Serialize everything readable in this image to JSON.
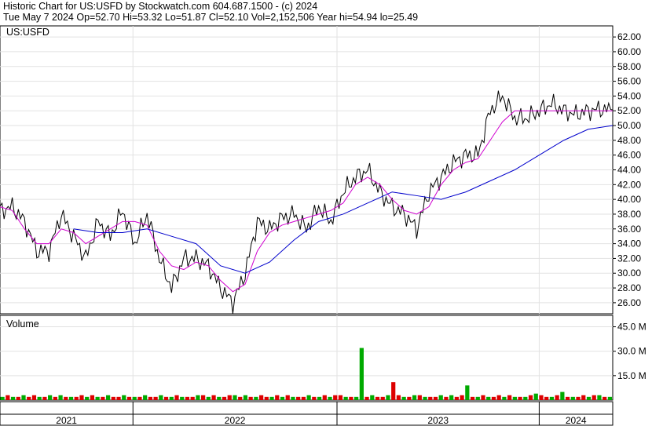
{
  "header": {
    "line1": "Historic Chart for US:USFD by Stockwatch.com 604.687.1500 - (c) 2024",
    "line2": "Tue May  7 2024  Op=52.70  Hi=53.32  Lo=51.87  Cl=52.10  Vol=2,152,506  Year hi=54.94  lo=25.49"
  },
  "chart_data": [
    {
      "type": "line",
      "panel": "price",
      "title": "US:USFD",
      "ylim": [
        24.5,
        63.5
      ],
      "yticks": [
        "62.00",
        "60.00",
        "58.00",
        "56.00",
        "54.00",
        "52.00",
        "50.00",
        "48.00",
        "46.00",
        "44.00",
        "42.00",
        "40.00",
        "38.00",
        "36.00",
        "34.00",
        "32.00",
        "30.00",
        "28.00",
        "26.00"
      ],
      "x_labels": [
        "2021",
        "2022",
        "2023",
        "2024"
      ],
      "grid": true,
      "colors": {
        "price": "#000000",
        "ma_short": "#d000d0",
        "ma_long": "#0000cc"
      },
      "series": [
        {
          "key": "price",
          "x": [
            0,
            0.02,
            0.04,
            0.06,
            0.08,
            0.1,
            0.12,
            0.14,
            0.16,
            0.18,
            0.2,
            0.22,
            0.24,
            0.26,
            0.28,
            0.3,
            0.32,
            0.34,
            0.36,
            0.38,
            0.4,
            0.42,
            0.44,
            0.46,
            0.48,
            0.5,
            0.52,
            0.54,
            0.56,
            0.58,
            0.6,
            0.62,
            0.64,
            0.66,
            0.68,
            0.7,
            0.72,
            0.74,
            0.76,
            0.78,
            0.8,
            0.82,
            0.84,
            0.86,
            0.88,
            0.9,
            0.92,
            0.94,
            0.96,
            0.98,
            1.0
          ],
          "values": [
            38.5,
            39,
            37,
            33,
            33,
            38,
            35,
            32,
            37,
            35,
            38.5,
            34,
            38,
            32,
            28,
            32,
            32,
            31,
            28,
            26,
            30,
            37,
            36,
            37.5,
            38,
            36,
            39,
            37,
            41,
            43,
            44,
            41,
            39,
            38,
            36,
            41,
            43,
            45,
            46,
            46,
            52,
            54,
            51,
            51,
            52,
            53,
            52,
            51.5,
            52,
            52.2,
            52.1
          ]
        },
        {
          "key": "ma_short",
          "x": [
            0,
            0.02,
            0.04,
            0.06,
            0.08,
            0.1,
            0.12,
            0.14,
            0.16,
            0.18,
            0.2,
            0.22,
            0.24,
            0.26,
            0.28,
            0.3,
            0.32,
            0.34,
            0.36,
            0.38,
            0.4,
            0.42,
            0.44,
            0.46,
            0.48,
            0.5,
            0.52,
            0.54,
            0.56,
            0.58,
            0.6,
            0.62,
            0.64,
            0.66,
            0.68,
            0.7,
            0.72,
            0.74,
            0.76,
            0.78,
            0.8,
            0.82,
            0.84,
            0.86,
            0.88,
            0.9,
            0.92,
            0.94,
            0.96,
            0.98,
            1.0
          ],
          "values": [
            39,
            38.5,
            36,
            34,
            34,
            36,
            35.5,
            34,
            35,
            36,
            37,
            37,
            36.5,
            33,
            31,
            30.5,
            31.5,
            31,
            29,
            27.5,
            28.5,
            33,
            35.5,
            36.5,
            37,
            37.5,
            38,
            38.5,
            39.5,
            42,
            43,
            42,
            40,
            38.5,
            38,
            39,
            42,
            44,
            45,
            45.5,
            48,
            50.5,
            52,
            52,
            52,
            52,
            52,
            52,
            52,
            52,
            52
          ]
        },
        {
          "key": "ma_long",
          "x": [
            0.12,
            0.16,
            0.2,
            0.24,
            0.28,
            0.32,
            0.36,
            0.4,
            0.44,
            0.48,
            0.52,
            0.56,
            0.6,
            0.64,
            0.68,
            0.72,
            0.76,
            0.8,
            0.84,
            0.88,
            0.92,
            0.96,
            1.0
          ],
          "values": [
            36,
            35.5,
            35.5,
            36,
            35,
            34,
            31,
            30,
            31.5,
            34.5,
            37,
            38,
            39.5,
            41,
            40.5,
            40,
            41,
            42.5,
            44,
            46,
            48,
            49.5,
            50
          ]
        }
      ]
    },
    {
      "type": "bar",
      "panel": "volume",
      "title": "Volume",
      "ylim": [
        0,
        52
      ],
      "yticks": [
        "45.0 M",
        "30.0 M",
        "15.0 M"
      ],
      "grid": true,
      "colors": {
        "up": "#00aa00",
        "down": "#dd0000"
      },
      "values": [
        2,
        3,
        2,
        2,
        3,
        2,
        3,
        2,
        2,
        3,
        2,
        3,
        2,
        2,
        2,
        3,
        2,
        3,
        2,
        2,
        3,
        2,
        2,
        3,
        2,
        2,
        2,
        3,
        2,
        2,
        3,
        2,
        2,
        3,
        2,
        2,
        2,
        3,
        3,
        2,
        3,
        2,
        2,
        3,
        3,
        2,
        3,
        2,
        2,
        3,
        2,
        2,
        3,
        2,
        3,
        2,
        2,
        2,
        3,
        2,
        2,
        3,
        2,
        3,
        3,
        2,
        2,
        2,
        32,
        2,
        3,
        2,
        2,
        3,
        11,
        3,
        2,
        2,
        3,
        3,
        2,
        2,
        2,
        3,
        2,
        3,
        2,
        3,
        9,
        2,
        2,
        3,
        2,
        2,
        3,
        2,
        3,
        2,
        2,
        2,
        3,
        4,
        3,
        2,
        2,
        3,
        5,
        2,
        2,
        2,
        3,
        2,
        3,
        3,
        2,
        2
      ],
      "up": [
        true,
        false,
        true,
        false,
        true,
        false,
        false,
        true,
        false,
        true,
        false,
        true,
        false,
        true,
        false,
        false,
        true,
        false,
        true,
        false,
        true,
        false,
        false,
        true,
        false,
        true,
        false,
        true,
        false,
        false,
        true,
        false,
        true,
        false,
        true,
        false,
        false,
        true,
        false,
        true,
        false,
        true,
        false,
        false,
        true,
        false,
        true,
        false,
        true,
        false,
        false,
        true,
        false,
        true,
        false,
        true,
        false,
        false,
        true,
        false,
        true,
        false,
        true,
        false,
        false,
        true,
        false,
        true,
        true,
        false,
        true,
        false,
        false,
        true,
        false,
        false,
        true,
        false,
        true,
        false,
        true,
        false,
        false,
        true,
        false,
        true,
        false,
        false,
        true,
        false,
        true,
        false,
        true,
        false,
        false,
        true,
        false,
        true,
        false,
        true,
        false,
        true,
        false,
        false,
        true,
        false,
        true,
        false,
        true,
        false,
        false,
        true,
        false,
        true,
        false,
        true
      ]
    }
  ]
}
